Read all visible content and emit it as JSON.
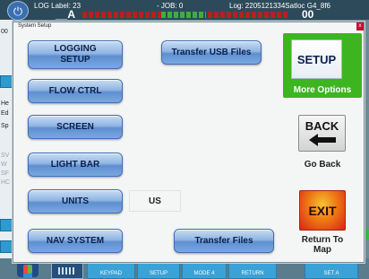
{
  "background": {
    "top_bar": {
      "log_label": "LOG Label: 23",
      "job_label": "- JOB: 0",
      "log_file": "Log: 2205121334Satloc G4_8f6",
      "left_big": "__A",
      "right_big": "00"
    },
    "left_fragments": [
      "00",
      "He",
      "Ed",
      "Sp",
      "SV",
      "W",
      "SF",
      "HC"
    ],
    "bottom_buttons": [
      "KEYPAD",
      "SETUP",
      "MODE 4",
      "RETURN",
      "SET A"
    ]
  },
  "dialog": {
    "title": "System Setup",
    "close_label": "x",
    "left_buttons": {
      "logging_setup": "LOGGING\nSETUP",
      "flow_ctrl": "FLOW CTRL",
      "screen": "SCREEN",
      "light_bar": "LIGHT BAR",
      "units": "UNITS",
      "nav_system": "NAV SYSTEM"
    },
    "units_value": "US",
    "transfer_usb_files": "Transfer USB Files",
    "transfer_files": "Transfer Files",
    "setup": {
      "icon_text": "SETUP",
      "label": "More Options"
    },
    "back": {
      "icon_text": "BACK",
      "label": "Go Back"
    },
    "exit": {
      "icon_text": "EXIT",
      "label_line1": "Return To",
      "label_line2": "Map"
    }
  },
  "colors": {
    "accent_green": "#3cb521",
    "button_blue": "#6f9ad8",
    "exit_red": "#d8241a"
  }
}
